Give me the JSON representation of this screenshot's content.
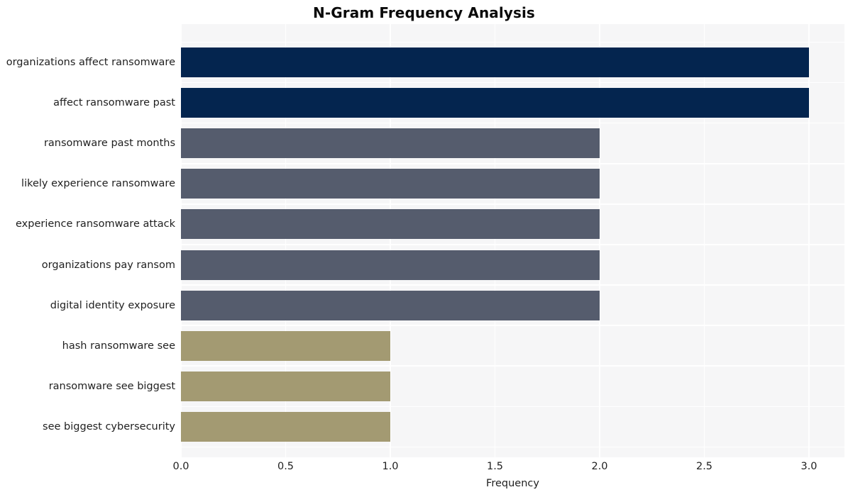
{
  "chart_data": {
    "type": "bar",
    "orientation": "horizontal",
    "title": "N-Gram Frequency Analysis",
    "xlabel": "Frequency",
    "ylabel": "",
    "xlim": [
      0,
      3.0
    ],
    "xticks": [
      "0.0",
      "0.5",
      "1.0",
      "1.5",
      "2.0",
      "2.5",
      "3.0"
    ],
    "xtick_values": [
      0,
      0.5,
      1.0,
      1.5,
      2.0,
      2.5,
      3.0
    ],
    "grid": true,
    "legend": "none",
    "categories": [
      "organizations affect ransomware",
      "affect ransomware past",
      "ransomware past months",
      "likely experience ransomware",
      "experience ransomware attack",
      "organizations pay ransom",
      "digital identity exposure",
      "hash ransomware see",
      "ransomware see biggest",
      "see biggest cybersecurity"
    ],
    "values": [
      3,
      3,
      2,
      2,
      2,
      2,
      2,
      1,
      1,
      1
    ],
    "bar_colors": [
      "#04254f",
      "#04254f",
      "#555c6d",
      "#555c6d",
      "#555c6d",
      "#555c6d",
      "#555c6d",
      "#a39a72",
      "#a39a72",
      "#a39a72"
    ]
  },
  "style": {
    "figure_background": "#ffffff",
    "plot_background": "#f6f6f7",
    "gridline_color": "#ffffff",
    "title_color": "#0a0a0a",
    "tick_label_color": "#1f1f1f"
  }
}
